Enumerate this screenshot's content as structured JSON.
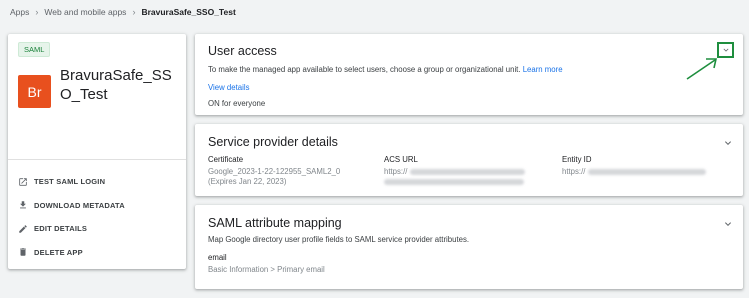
{
  "breadcrumb": {
    "items": [
      "Apps",
      "Web and mobile apps",
      "BravuraSafe_SSO_Test"
    ]
  },
  "app": {
    "badge": "SAML",
    "logo_text": "Br",
    "logo_color": "#e8501e",
    "name": "BravuraSafe_SSO_Test"
  },
  "actions": [
    {
      "label": "TEST SAML LOGIN",
      "icon": "external-link-icon"
    },
    {
      "label": "DOWNLOAD METADATA",
      "icon": "download-icon"
    },
    {
      "label": "EDIT DETAILS",
      "icon": "pencil-icon"
    },
    {
      "label": "DELETE APP",
      "icon": "trash-icon"
    }
  ],
  "user_access": {
    "title": "User access",
    "description": "To make the managed app available to select users, choose a group or organizational unit.",
    "learn_more": "Learn more",
    "view_details": "View details",
    "status": "ON for everyone"
  },
  "service_provider": {
    "title": "Service provider details",
    "certificate_label": "Certificate",
    "certificate_value": "Google_2023-1-22-122955_SAML2_0",
    "certificate_expiry": "(Expires Jan 22, 2023)",
    "acs_label": "ACS URL",
    "acs_prefix": "https://",
    "entity_label": "Entity ID",
    "entity_prefix": "https://"
  },
  "saml_mapping": {
    "title": "SAML attribute mapping",
    "description": "Map Google directory user profile fields to SAML service provider attributes.",
    "attr_name": "email",
    "attr_source": "Basic Information > Primary email"
  },
  "colors": {
    "accent": "#1a73e8",
    "annotation": "#1e8e3e",
    "badge_text": "#188038"
  }
}
